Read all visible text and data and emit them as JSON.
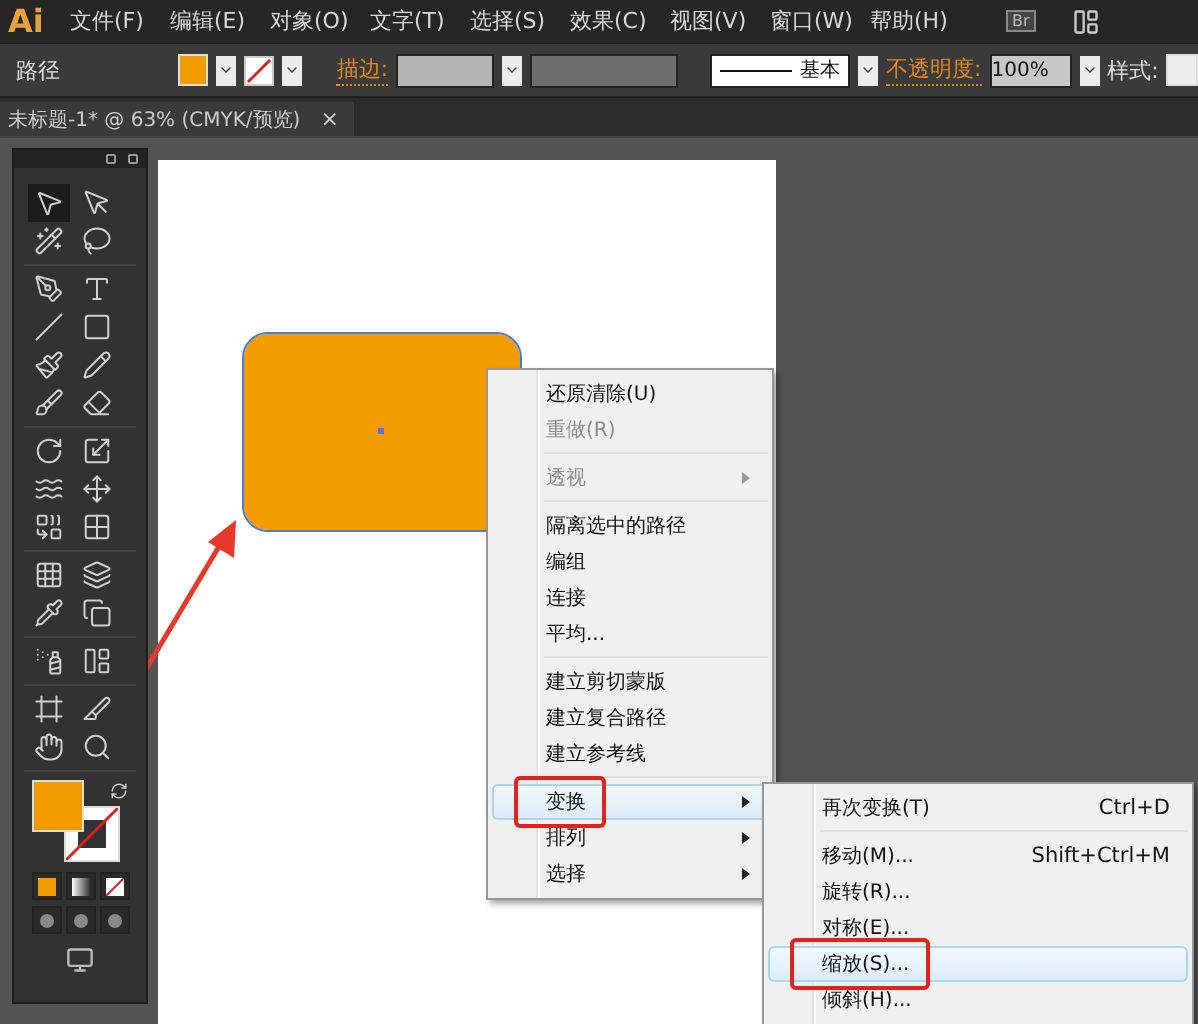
{
  "app": {
    "logo": "Ai",
    "menus": [
      "文件(F)",
      "编辑(E)",
      "对象(O)",
      "文字(T)",
      "选择(S)",
      "效果(C)",
      "视图(V)",
      "窗口(W)",
      "帮助(H)"
    ],
    "bridge": "Br"
  },
  "control_bar": {
    "object": "路径",
    "stroke_label": "描边:",
    "brush": "基本",
    "opacity_label": "不透明度:",
    "opacity": "100%",
    "style_label": "样式:"
  },
  "document_tab": {
    "title": "未标题-1* @ 63% (CMYK/预览)",
    "close": "×"
  },
  "tool_groups": [
    [
      {
        "kind": "select",
        "selected": true
      },
      {
        "kind": "direct",
        "selected": false
      },
      {
        "kind": "wand",
        "selected": false
      },
      {
        "kind": "lasso",
        "selected": false
      }
    ],
    [
      {
        "kind": "pen",
        "selected": false
      },
      {
        "kind": "type",
        "selected": false
      },
      {
        "kind": "line",
        "selected": false
      },
      {
        "kind": "rect",
        "selected": false
      },
      {
        "kind": "brush",
        "selected": false
      },
      {
        "kind": "pencil",
        "selected": false
      },
      {
        "kind": "blob",
        "selected": false
      },
      {
        "kind": "eraser",
        "selected": false
      }
    ],
    [
      {
        "kind": "rotate",
        "selected": false
      },
      {
        "kind": "scale",
        "selected": false
      },
      {
        "kind": "warp",
        "selected": false
      },
      {
        "kind": "transform",
        "selected": false
      },
      {
        "kind": "shapebuilder",
        "selected": false
      },
      {
        "kind": "perspective",
        "selected": false
      }
    ],
    [
      {
        "kind": "mesh",
        "selected": false
      },
      {
        "kind": "gradient",
        "selected": false
      },
      {
        "kind": "eyedropper",
        "selected": false
      },
      {
        "kind": "blend",
        "selected": false
      }
    ],
    [
      {
        "kind": "spray",
        "selected": false
      },
      {
        "kind": "graph",
        "selected": false
      }
    ],
    [
      {
        "kind": "artboard",
        "selected": false
      },
      {
        "kind": "slice",
        "selected": false
      },
      {
        "kind": "hand",
        "selected": false
      },
      {
        "kind": "zoom",
        "selected": false
      }
    ]
  ],
  "context_menu": [
    {
      "kind": "item",
      "label": "还原清除(U)",
      "disabled": false,
      "submenu": false,
      "highlighted": false,
      "marked": false
    },
    {
      "kind": "item",
      "label": "重做(R)",
      "disabled": true,
      "submenu": false,
      "highlighted": false,
      "marked": false
    },
    {
      "kind": "separator"
    },
    {
      "kind": "item",
      "label": "透视",
      "disabled": true,
      "submenu": true,
      "highlighted": false,
      "marked": false
    },
    {
      "kind": "separator"
    },
    {
      "kind": "item",
      "label": "隔离选中的路径",
      "disabled": false,
      "submenu": false,
      "highlighted": false,
      "marked": false
    },
    {
      "kind": "item",
      "label": "编组",
      "disabled": false,
      "submenu": false,
      "highlighted": false,
      "marked": false
    },
    {
      "kind": "item",
      "label": "连接",
      "disabled": false,
      "submenu": false,
      "highlighted": false,
      "marked": false
    },
    {
      "kind": "item",
      "label": "平均...",
      "disabled": false,
      "submenu": false,
      "highlighted": false,
      "marked": false
    },
    {
      "kind": "separator"
    },
    {
      "kind": "item",
      "label": "建立剪切蒙版",
      "disabled": false,
      "submenu": false,
      "highlighted": false,
      "marked": false
    },
    {
      "kind": "item",
      "label": "建立复合路径",
      "disabled": false,
      "submenu": false,
      "highlighted": false,
      "marked": false
    },
    {
      "kind": "item",
      "label": "建立参考线",
      "disabled": false,
      "submenu": false,
      "highlighted": false,
      "marked": false
    },
    {
      "kind": "separator"
    },
    {
      "kind": "item",
      "label": "变换",
      "disabled": false,
      "submenu": true,
      "highlighted": true,
      "marked": true
    },
    {
      "kind": "item",
      "label": "排列",
      "disabled": false,
      "submenu": true,
      "highlighted": false,
      "marked": false
    },
    {
      "kind": "item",
      "label": "选择",
      "disabled": false,
      "submenu": true,
      "highlighted": false,
      "marked": false
    }
  ],
  "submenu": [
    {
      "kind": "item",
      "label": "再次变换(T)",
      "shortcut": "Ctrl+D",
      "highlighted": false,
      "marked": false
    },
    {
      "kind": "separator"
    },
    {
      "kind": "item",
      "label": "移动(M)...",
      "shortcut": "Shift+Ctrl+M",
      "highlighted": false,
      "marked": false
    },
    {
      "kind": "item",
      "label": "旋转(R)...",
      "highlighted": false,
      "marked": false
    },
    {
      "kind": "item",
      "label": "对称(E)...",
      "highlighted": false,
      "marked": false
    },
    {
      "kind": "item",
      "label": "缩放(S)...",
      "highlighted": true,
      "marked": true
    },
    {
      "kind": "item",
      "label": "倾斜(H)...",
      "highlighted": false,
      "marked": false
    }
  ]
}
